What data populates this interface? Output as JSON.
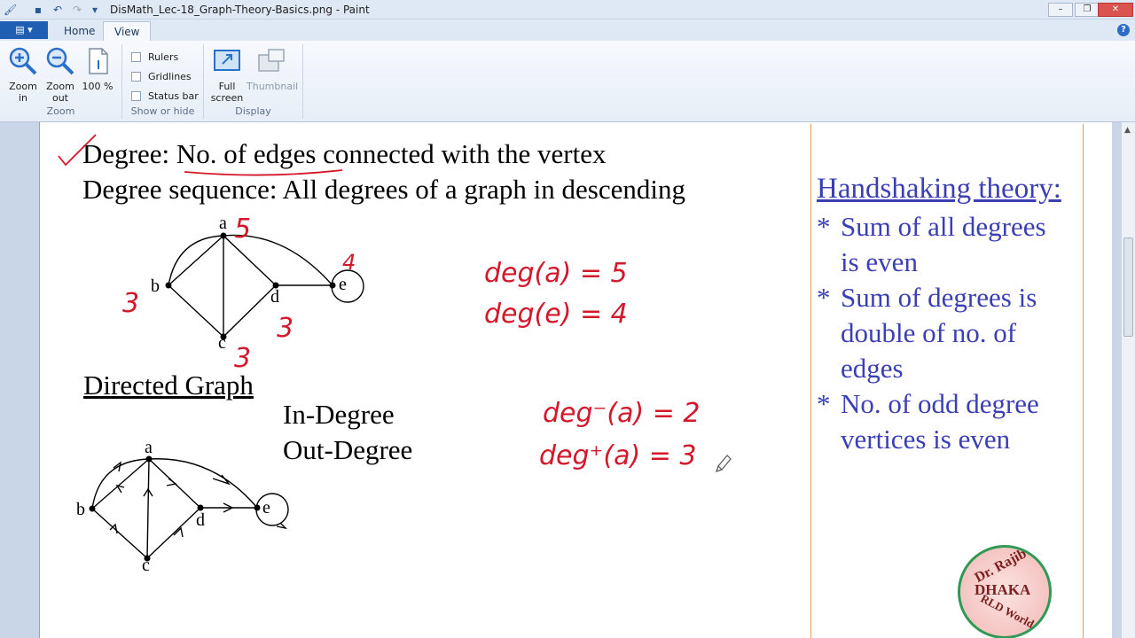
{
  "window": {
    "title": "DisMath_Lec-18_Graph-Theory-Basics.png - Paint",
    "minimize": "–",
    "maximize": "❐",
    "close": "✕"
  },
  "ribbon": {
    "file_menu": "▤ ▾",
    "tabs": [
      "Home",
      "View"
    ],
    "help": "?",
    "zoom_group": {
      "label": "Zoom",
      "zoom_in": "Zoom in",
      "zoom_out": "Zoom out",
      "hundred": "100 %"
    },
    "show_group": {
      "label": "Show or hide",
      "rulers": "Rulers",
      "gridlines": "Gridlines",
      "status_bar": "Status bar"
    },
    "display_group": {
      "label": "Display",
      "full_screen": "Full screen",
      "thumbnail": "Thumbnail"
    }
  },
  "slide": {
    "line1_prefix": "Degree: ",
    "line1_underlined": "No. of edges",
    "line1_suffix": " connected with the vertex",
    "line2": "Degree sequence: All degrees of a graph in descending",
    "directed_heading": "Directed Graph",
    "in_degree": "In-Degree",
    "out_degree": "Out-Degree",
    "vertices": [
      "a",
      "b",
      "c",
      "d",
      "e"
    ],
    "handshaking": {
      "title": "Handshaking theory:",
      "items": [
        [
          "*",
          "Sum of all degrees",
          "is even"
        ],
        [
          "*",
          "Sum of degrees is",
          "double of no. of",
          "edges"
        ],
        [
          "*",
          "No. of odd degree",
          "vertices is even"
        ]
      ]
    },
    "annotations": {
      "deg_a": "5",
      "deg_e": "4",
      "deg_b": "3",
      "deg_d": "3",
      "deg_c": "3",
      "eq1": "deg(a) = 5",
      "eq2": "deg(e) = 4",
      "eq3": "deg⁻(a) = 2",
      "eq4": "deg⁺(a) = 3"
    },
    "watermark": {
      "top": "Dr. Rajib",
      "middle": "DHAKA",
      "bottom": "RLD World"
    }
  }
}
